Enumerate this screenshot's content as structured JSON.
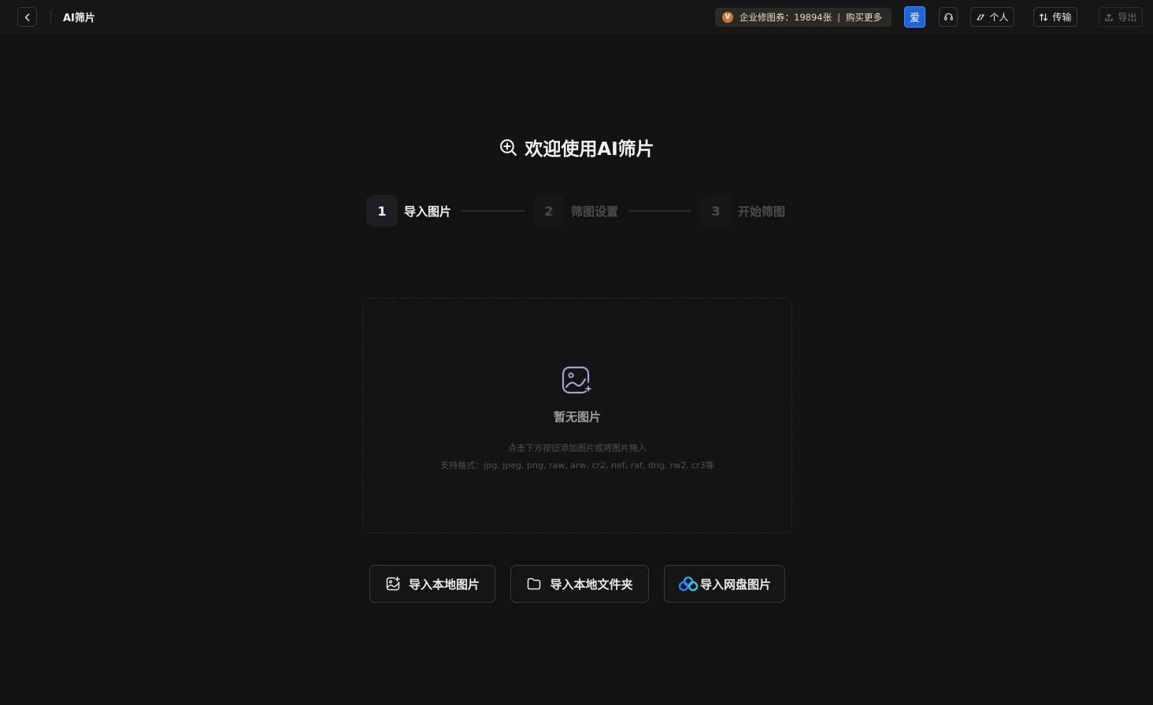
{
  "topbar": {
    "title": "AI筛片",
    "voucher": {
      "badge": "V",
      "text": "企业修图券：19894张",
      "separator": "|",
      "buy_more": "购买更多"
    },
    "ai_badge": "爱",
    "personal_label": "个人",
    "transfer_label": "传输",
    "export_label": "导出"
  },
  "main": {
    "welcome_title": "欢迎使用AI筛片",
    "steps": [
      {
        "number": "1",
        "label": "导入图片",
        "active": true
      },
      {
        "number": "2",
        "label": "筛图设置",
        "active": false
      },
      {
        "number": "3",
        "label": "开始筛图",
        "active": false
      }
    ],
    "dropzone": {
      "empty_title": "暂无图片",
      "hint_line1": "点击下方按钮添加图片或将图片拖入",
      "hint_line2": "支持格式：jpg, jpeg, png, raw, arw, cr2, nef, raf, dng, rw2, cr3等"
    },
    "import_buttons": {
      "local_images": "导入本地图片",
      "local_folder": "导入本地文件夹",
      "cloud_images": "导入网盘图片"
    }
  },
  "colors": {
    "background": "#121213",
    "accent_blue": "#1d65d8",
    "voucher_bg": "#2b2925",
    "voucher_badge": "#c9763a"
  }
}
